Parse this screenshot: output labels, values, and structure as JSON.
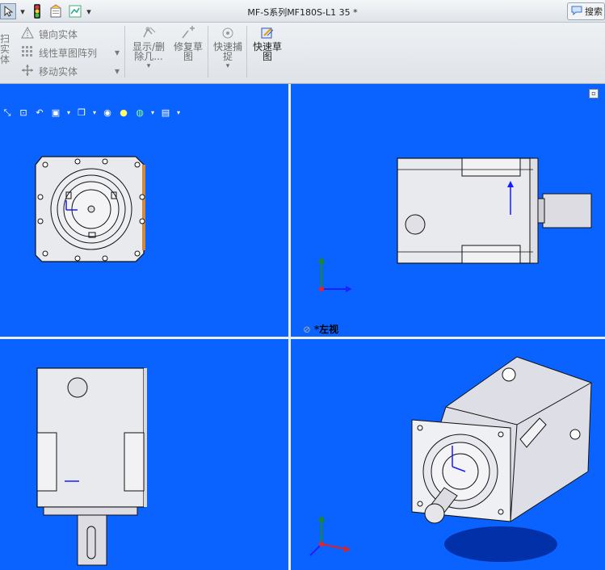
{
  "window": {
    "title": "MF-S系列MF180S-L1 35 *"
  },
  "search": {
    "label": "搜索"
  },
  "ribbon": {
    "partial_left": "扫实\n体",
    "mirror": "镜向实体",
    "linear_pattern": "线性草图阵列",
    "move": "移动实体",
    "show_delete": "显示/删\n除几...",
    "repair": "修复草\n图",
    "quick_snap": "快速捕\n捉",
    "quick_sketch": "快速草\n图"
  },
  "viewports": {
    "top_right_label": "*左视"
  },
  "colors": {
    "viewport_bg": "#0b63ff",
    "divider": "#e9eef4"
  }
}
